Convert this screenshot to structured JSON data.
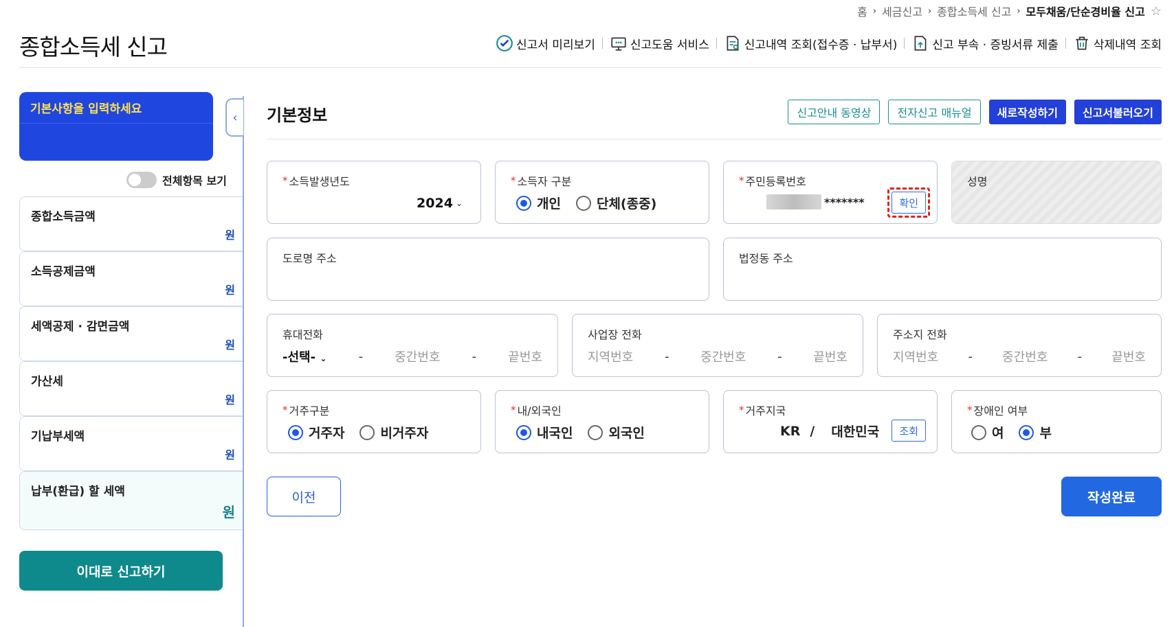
{
  "breadcrumb": {
    "items": [
      "홈",
      "세금신고",
      "종합소득세 신고"
    ],
    "current": "모두채움/단순경비율 신고"
  },
  "page": {
    "title": "종합소득세 신고"
  },
  "toplinks": [
    {
      "label": "신고서 미리보기",
      "icon": "check-circle-icon"
    },
    {
      "label": "신고도움 서비스",
      "icon": "monitor-chat-icon"
    },
    {
      "label": "신고내역 조회(접수증 · 납부서)",
      "icon": "doc-search-icon"
    },
    {
      "label": "신고 부속 · 증빙서류 제출",
      "icon": "doc-upload-icon"
    },
    {
      "label": "삭제내역 조회",
      "icon": "trash-icon"
    }
  ],
  "sidebar": {
    "banner": "기본사항을 입력하세요",
    "toggle_label": "전체항목 보기",
    "items": [
      {
        "label": "종합소득금액",
        "unit": "원"
      },
      {
        "label": "소득공제금액",
        "unit": "원"
      },
      {
        "label": "세액공제 · 감면금액",
        "unit": "원"
      },
      {
        "label": "가산세",
        "unit": "원"
      },
      {
        "label": "기납부세액",
        "unit": "원"
      },
      {
        "label": "납부(환급) 할 세액",
        "unit": "원"
      }
    ],
    "submit": "이대로 신고하기",
    "collapse": "‹"
  },
  "main": {
    "section_title": "기본정보",
    "buttons": {
      "video": "신고안내 동영상",
      "manual": "전자신고 매뉴얼",
      "new": "새로작성하기",
      "load": "신고서불러오기"
    },
    "year": {
      "label": "소득발생년도",
      "value": "2024"
    },
    "owner_type": {
      "label": "소득자 구분",
      "opt1": "개인",
      "opt2": "단체(종중)"
    },
    "rrn": {
      "label": "주민등록번호",
      "masked": "*******",
      "confirm": "확인"
    },
    "name": {
      "label": "성명"
    },
    "road_addr": {
      "label": "도로명 주소"
    },
    "lot_addr": {
      "label": "법정동 주소"
    },
    "mobile": {
      "label": "휴대전화",
      "select": "-선택-",
      "mid": "중간번호",
      "end": "끝번호"
    },
    "biz_phone": {
      "label": "사업장 전화",
      "area": "지역번호",
      "mid": "중간번호",
      "end": "끝번호"
    },
    "home_phone": {
      "label": "주소지 전화",
      "area": "지역번호",
      "mid": "중간번호",
      "end": "끝번호"
    },
    "residence": {
      "label": "거주구분",
      "opt1": "거주자",
      "opt2": "비거주자"
    },
    "nationality": {
      "label": "내/외국인",
      "opt1": "내국인",
      "opt2": "외국인"
    },
    "country": {
      "label": "거주지국",
      "code": "KR",
      "slash": "/",
      "name": "대한민국",
      "lookup": "조회"
    },
    "disability": {
      "label": "장애인 여부",
      "opt1": "여",
      "opt2": "부"
    },
    "dash": "-",
    "prev": "이전",
    "done": "작성완료"
  },
  "colors": {
    "primary": "#2340d8",
    "teal": "#0e8a8c",
    "banner": "#1f47e0",
    "banner_text": "#ffe14f"
  }
}
